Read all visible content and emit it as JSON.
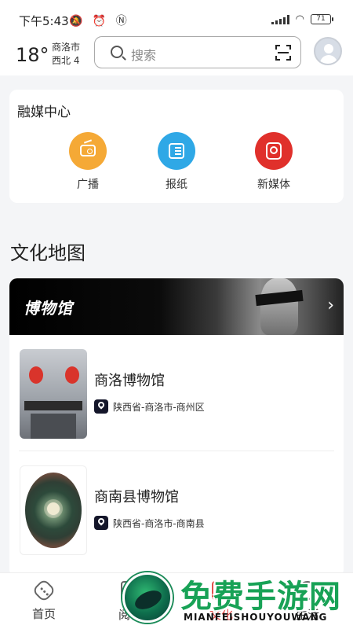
{
  "status_bar": {
    "time": "下午5:43",
    "left_icons": "🔕 ⏰ Ⓝ",
    "battery": "71"
  },
  "header": {
    "temperature": "18°",
    "city": "商洛市",
    "wind": "西北 4",
    "search_placeholder": "搜索"
  },
  "media_center": {
    "title": "融媒中心",
    "items": [
      {
        "label": "广播",
        "icon": "radio-icon",
        "color": "#f5a936"
      },
      {
        "label": "报纸",
        "icon": "newspaper-icon",
        "color": "#2fa8e6"
      },
      {
        "label": "新媒体",
        "icon": "new-media-icon",
        "color": "#e0302b"
      }
    ]
  },
  "culture_map": {
    "title": "文化地图",
    "banner_title": "博物馆",
    "museums": [
      {
        "name": "商洛博物馆",
        "location": "陕西省-商洛市-商州区"
      },
      {
        "name": "商南县博物馆",
        "location": "陕西省-商洛市-商南县"
      }
    ]
  },
  "bottom_nav": {
    "items": [
      {
        "label": "首页",
        "icon": "home-icon"
      },
      {
        "label": "阅读",
        "icon": "read-icon"
      },
      {
        "label": "文化",
        "icon": "culture-icon",
        "active": true
      },
      {
        "label": "生活",
        "icon": "life-icon"
      }
    ]
  },
  "watermark": {
    "title": "免费手游网",
    "subtitle": "MIANFEISHOUYOUWANG"
  },
  "colors": {
    "accent": "#e2504d",
    "background": "#f4f5f7"
  }
}
